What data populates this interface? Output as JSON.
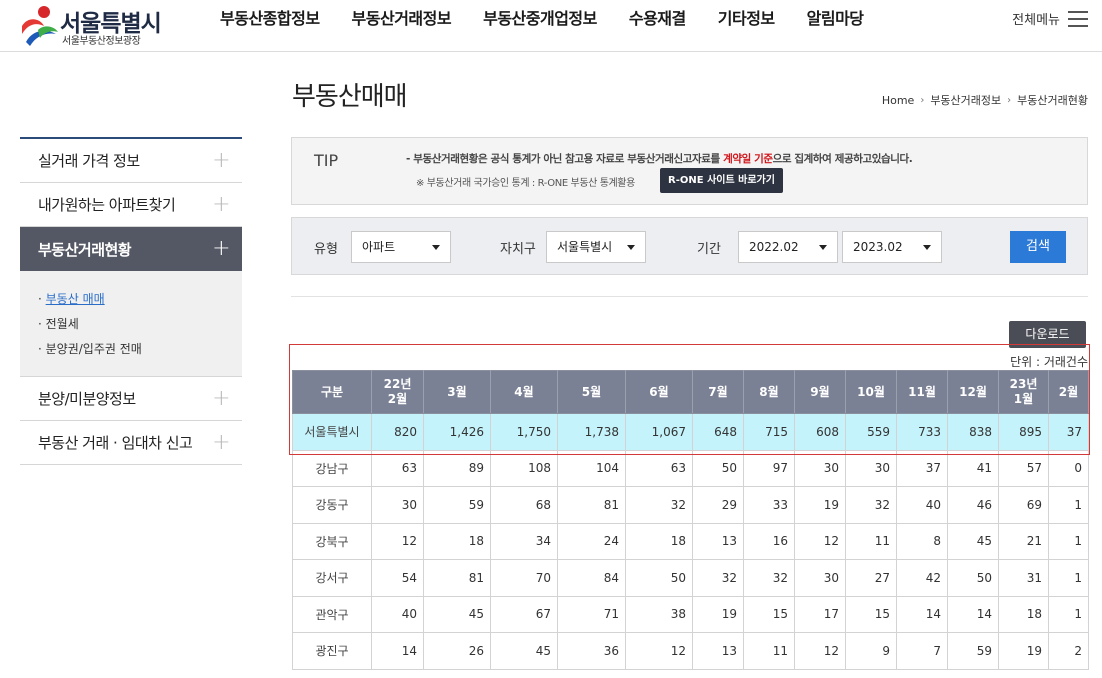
{
  "header": {
    "logo_title": "서울특별시",
    "logo_sub": "서울부동산정보광장",
    "nav": [
      "부동산종합정보",
      "부동산거래정보",
      "부동산중개업정보",
      "수용재결",
      "기타정보",
      "알림마당"
    ],
    "all_menu_label": "전체메뉴"
  },
  "page": {
    "title": "부동산매매",
    "breadcrumb": [
      "Home",
      "부동산거래정보",
      "부동산거래현황"
    ]
  },
  "sidebar": {
    "items": [
      {
        "label": "실거래 가격 정보",
        "active": false
      },
      {
        "label": "내가원하는 아파트찾기",
        "active": false
      },
      {
        "label": "부동산거래현황",
        "active": true
      },
      {
        "label": "분양/미분양정보",
        "active": false
      },
      {
        "label": "부동산 거래 · 임대차 신고",
        "active": false
      }
    ],
    "sub_items": [
      "부동산 매매",
      "전월세",
      "분양권/입주권 전매"
    ]
  },
  "tip": {
    "label": "TIP",
    "line1_a": "-  부동산거래현황은 공식 통계가 아닌 참고용 자료로 부동산거래신고자료를 ",
    "line1_red": "계약일 기준",
    "line1_b": "으로 집계하여 제공하고있습니다.",
    "line2": "※ 부동산거래 국가승인 통계 : R-ONE 부동산 통계활용",
    "rone_button": "R-ONE 사이트 바로가기"
  },
  "search": {
    "type_label": "유형",
    "type_value": "아파트",
    "district_label": "자치구",
    "district_value": "서울특별시",
    "period_label": "기간",
    "period_from": "2022.02",
    "period_to": "2023.02",
    "search_button": "검색"
  },
  "download_button": "다운로드",
  "unit_text": "단위  :  거래건수",
  "colors": {
    "header_bg": "#7b8194",
    "highlight_row": "#c5f3fb",
    "search_btn": "#2b7ad8",
    "sidebar_active": "#545864",
    "red_text": "#d0151b"
  },
  "table": {
    "headers": [
      "구분",
      "22년\n2월",
      "3월",
      "4월",
      "5월",
      "6월",
      "7월",
      "8월",
      "9월",
      "10월",
      "11월",
      "12월",
      "23년\n1월",
      "2월"
    ],
    "rows": [
      {
        "name": "서울특별시",
        "values": [
          "820",
          "1,426",
          "1,750",
          "1,738",
          "1,067",
          "648",
          "715",
          "608",
          "559",
          "733",
          "838",
          "895",
          "37"
        ],
        "highlight": true
      },
      {
        "name": "강남구",
        "values": [
          "63",
          "89",
          "108",
          "104",
          "63",
          "50",
          "97",
          "30",
          "30",
          "37",
          "41",
          "57",
          "0"
        ]
      },
      {
        "name": "강동구",
        "values": [
          "30",
          "59",
          "68",
          "81",
          "32",
          "29",
          "33",
          "19",
          "32",
          "40",
          "46",
          "69",
          "1"
        ]
      },
      {
        "name": "강북구",
        "values": [
          "12",
          "18",
          "34",
          "24",
          "18",
          "13",
          "16",
          "12",
          "11",
          "8",
          "45",
          "21",
          "1"
        ]
      },
      {
        "name": "강서구",
        "values": [
          "54",
          "81",
          "70",
          "84",
          "50",
          "32",
          "32",
          "30",
          "27",
          "42",
          "50",
          "31",
          "1"
        ]
      },
      {
        "name": "관악구",
        "values": [
          "40",
          "45",
          "67",
          "71",
          "38",
          "19",
          "15",
          "17",
          "15",
          "14",
          "14",
          "18",
          "1"
        ]
      },
      {
        "name": "광진구",
        "values": [
          "14",
          "26",
          "45",
          "36",
          "12",
          "13",
          "11",
          "12",
          "9",
          "7",
          "59",
          "19",
          "2"
        ]
      }
    ]
  }
}
